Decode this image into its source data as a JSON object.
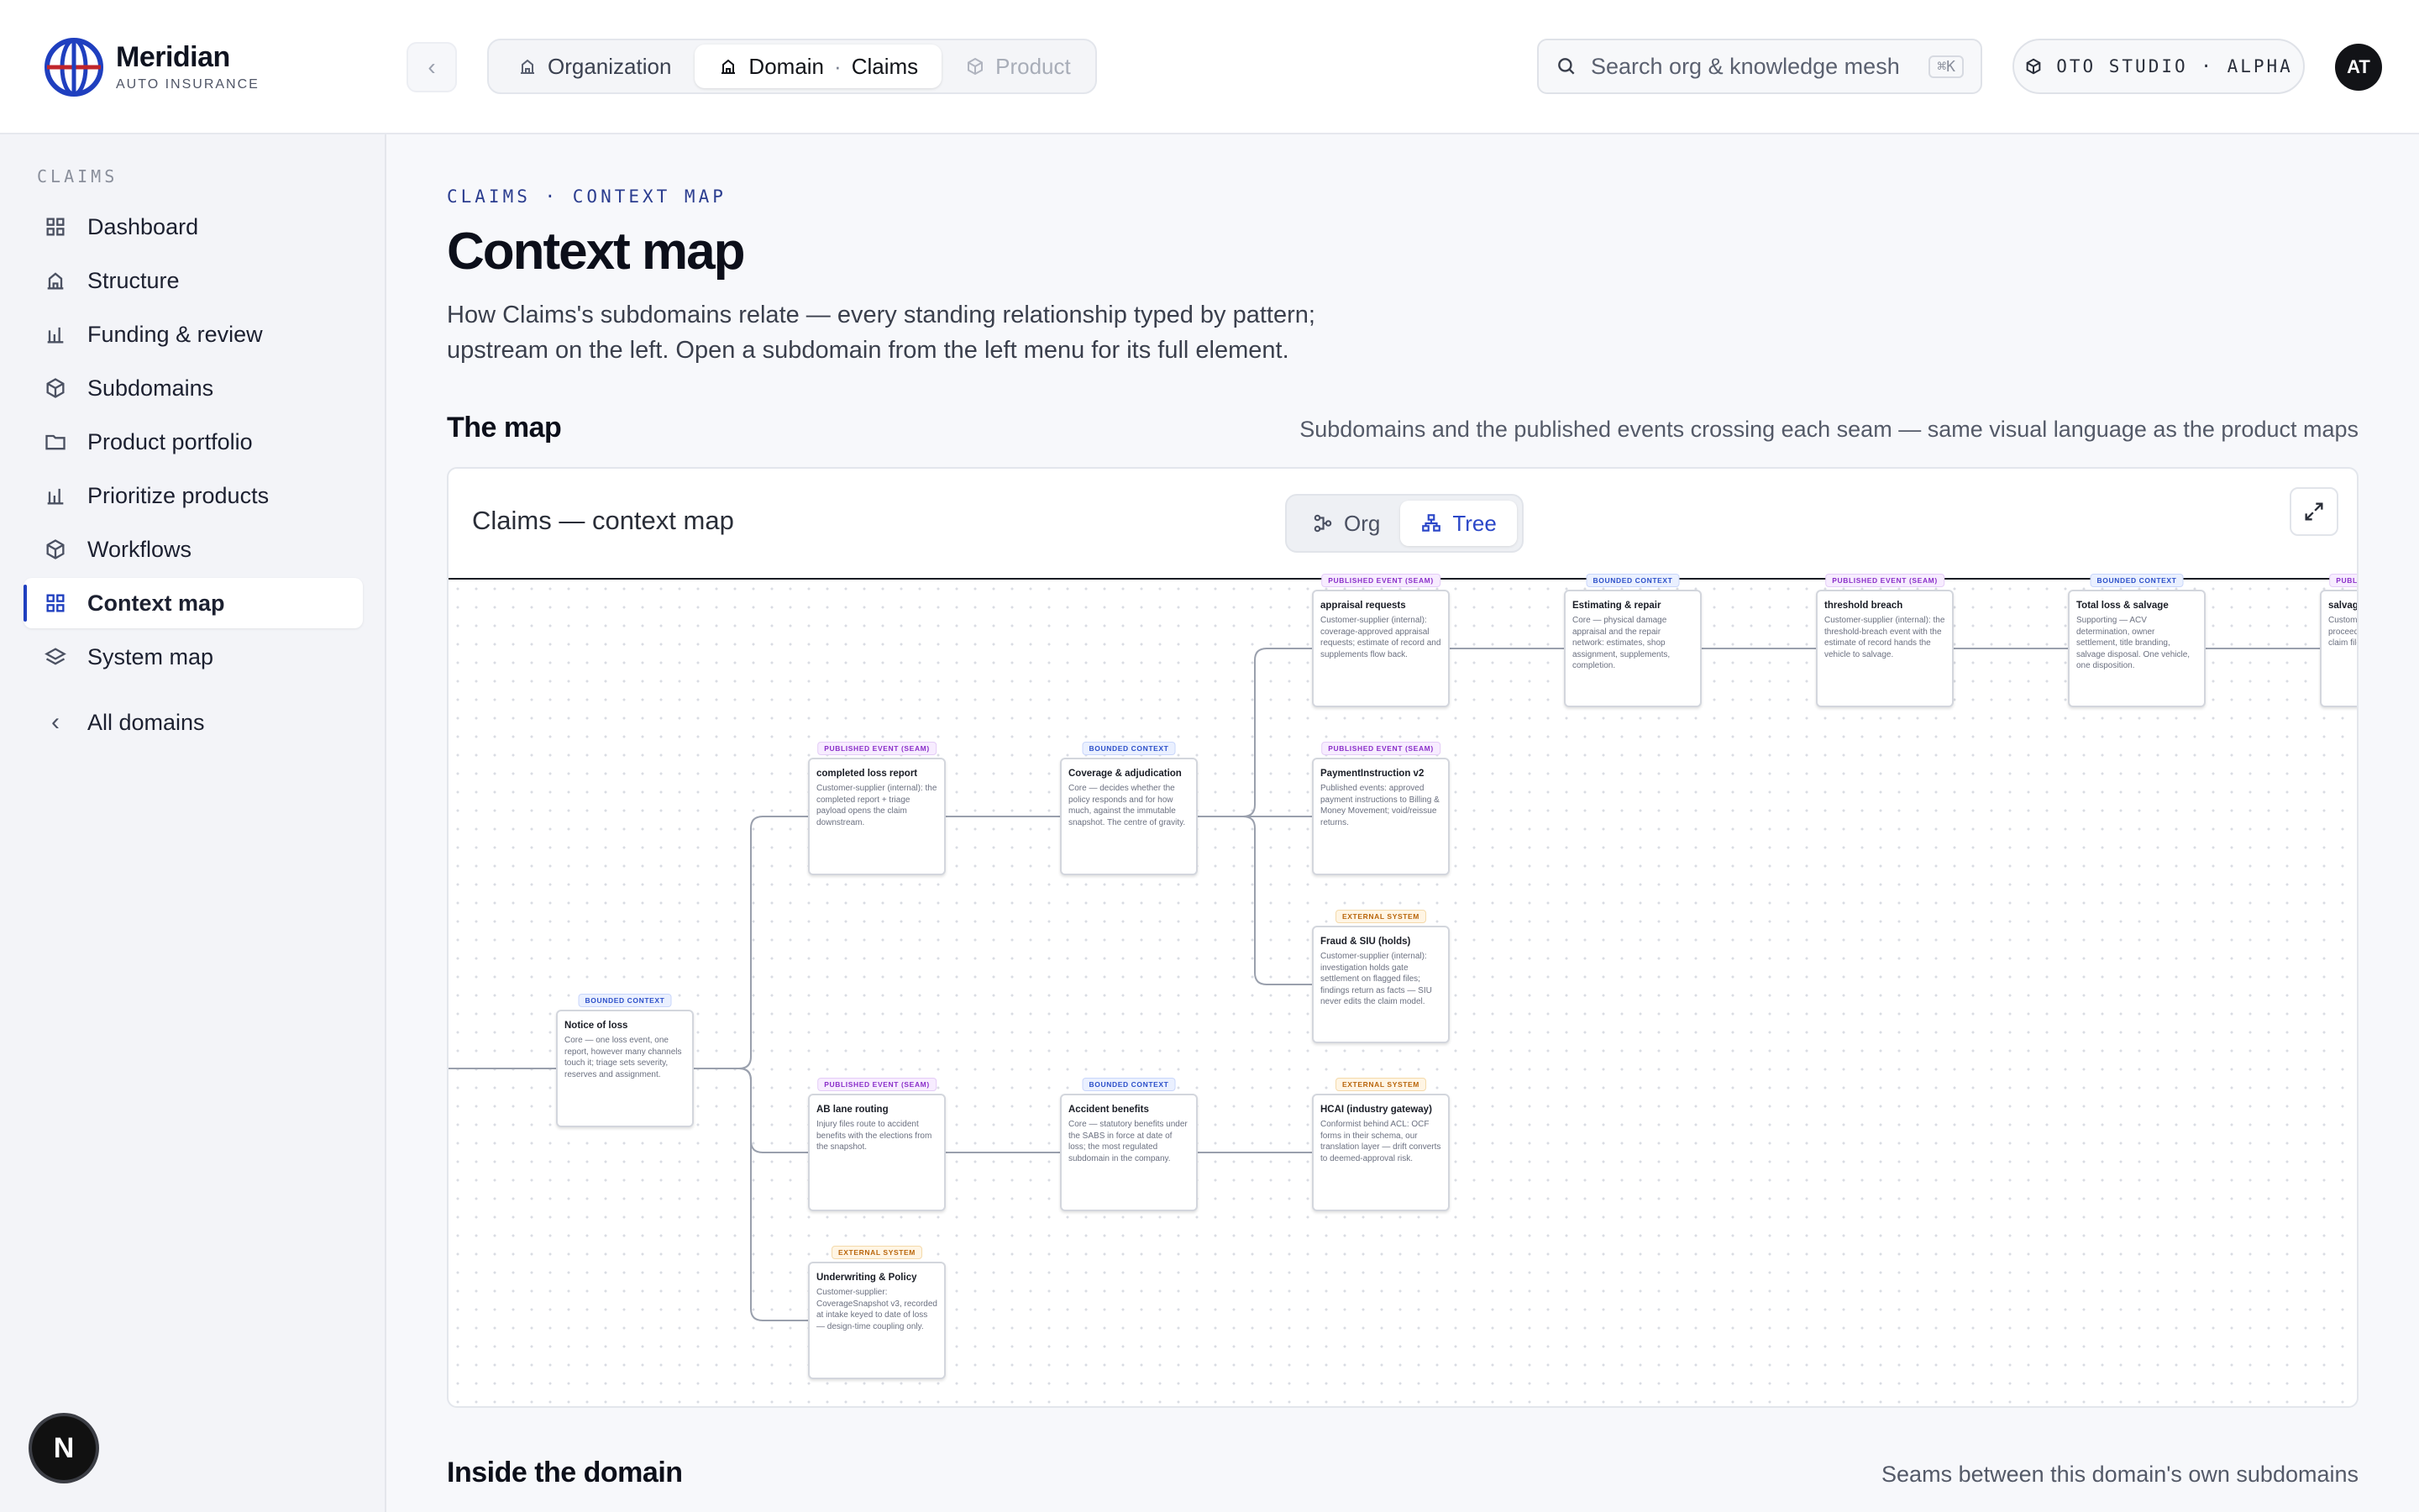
{
  "brand": {
    "name": "Meridian",
    "sub": "AUTO INSURANCE"
  },
  "scope": {
    "organization": "Organization",
    "domain": "Domain",
    "domain_current": "Claims",
    "product": "Product"
  },
  "search": {
    "placeholder": "Search org & knowledge mesh",
    "shortcut": "⌘K"
  },
  "studio": "OTO STUDIO · ALPHA",
  "user": {
    "initials": "AT"
  },
  "sidebar": {
    "section": "CLAIMS",
    "items": [
      {
        "label": "Dashboard",
        "icon": "grid-icon"
      },
      {
        "label": "Structure",
        "icon": "building-icon"
      },
      {
        "label": "Funding & review",
        "icon": "bar-chart-icon"
      },
      {
        "label": "Subdomains",
        "icon": "cube-icon"
      },
      {
        "label": "Product portfolio",
        "icon": "folder-icon"
      },
      {
        "label": "Prioritize products",
        "icon": "bar-chart-icon"
      },
      {
        "label": "Workflows",
        "icon": "cube-icon"
      },
      {
        "label": "Context map",
        "icon": "grid-icon",
        "active": true
      },
      {
        "label": "System map",
        "icon": "layers-icon"
      }
    ],
    "all_domains": "All domains"
  },
  "badge": "N",
  "page": {
    "eyebrow": "CLAIMS · CONTEXT MAP",
    "title": "Context map",
    "description": "How Claims's subdomains relate — every standing relationship typed by pattern; upstream on the left. Open a subdomain from the left menu for its full element."
  },
  "map_section": {
    "title": "The map",
    "hint": "Subdomains and the published events crossing each seam — same visual language as the product maps"
  },
  "map": {
    "title": "Claims — context map",
    "toggle": {
      "org": "Org",
      "tree": "Tree",
      "active": "tree"
    },
    "tags": {
      "bc": "BOUNDED CONTEXT",
      "pe": "PUBLISHED EVENT (SEAM)",
      "ex": "EXTERNAL SYSTEM"
    },
    "nodes": [
      {
        "id": "nol",
        "kind": "bc",
        "title": "Notice of loss",
        "desc": "Core — one loss event, one report, however many channels touch it; triage sets severity, reserves and assignment."
      },
      {
        "id": "clr",
        "kind": "pe",
        "title": "completed loss report",
        "desc": "Customer-supplier (internal): the completed report + triage payload opens the claim downstream."
      },
      {
        "id": "cov",
        "kind": "bc",
        "title": "Coverage & adjudication",
        "desc": "Core — decides whether the policy responds and for how much, against the immutable snapshot. The centre of gravity."
      },
      {
        "id": "apr",
        "kind": "pe",
        "title": "appraisal requests",
        "desc": "Customer-supplier (internal): coverage-approved appraisal requests; estimate of record and supplements flow back."
      },
      {
        "id": "est",
        "kind": "bc",
        "title": "Estimating & repair",
        "desc": "Core — physical damage appraisal and the repair network: estimates, shop assignment, supplements, completion."
      },
      {
        "id": "thr",
        "kind": "pe",
        "title": "threshold breach",
        "desc": "Customer-supplier (internal): the threshold-breach event with the estimate of record hands the vehicle to salvage."
      },
      {
        "id": "tls",
        "kind": "bc",
        "title": "Total loss & salvage",
        "desc": "Supporting — ACV determination, owner settlement, title branding, salvage disposal. One vehicle, one disposition."
      },
      {
        "id": "slv",
        "kind": "pe",
        "title": "salvage proceeds",
        "desc": "Customer-supplier: salvage proceeds split facts back to the claim file."
      },
      {
        "id": "pay",
        "kind": "pe",
        "title": "PaymentInstruction v2",
        "desc": "Published events: approved payment instructions to Billing & Money Movement; void/reissue returns."
      },
      {
        "id": "frd",
        "kind": "ex",
        "title": "Fraud & SIU (holds)",
        "desc": "Customer-supplier (internal): investigation holds gate settlement on flagged files; findings return as facts — SIU never edits the claim model."
      },
      {
        "id": "abl",
        "kind": "pe",
        "title": "AB lane routing",
        "desc": "Injury files route to accident benefits with the elections from the snapshot."
      },
      {
        "id": "acc",
        "kind": "bc",
        "title": "Accident benefits",
        "desc": "Core — statutory benefits under the SABS in force at date of loss; the most regulated subdomain in the company."
      },
      {
        "id": "hca",
        "kind": "ex",
        "title": "HCAI (industry gateway)",
        "desc": "Conformist behind ACL: OCF forms in their schema, our translation layer — drift converts to deemed-approval risk."
      },
      {
        "id": "uwp",
        "kind": "ex",
        "title": "Underwriting & Policy",
        "desc": "Customer-supplier: CoverageSnapshot v3, recorded at intake keyed to date of loss — design-time coupling only."
      }
    ]
  },
  "inside_section": {
    "title": "Inside the domain",
    "hint": "Seams between this domain's own subdomains"
  }
}
